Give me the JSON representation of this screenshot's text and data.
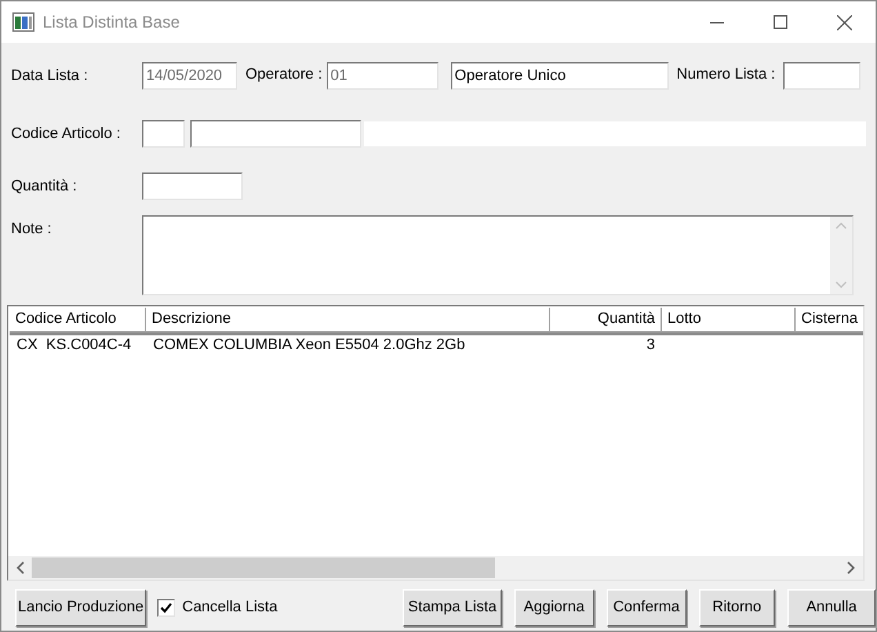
{
  "window": {
    "title": "Lista Distinta Base"
  },
  "form": {
    "data_lista": {
      "label": "Data Lista :",
      "value": "14/05/2020"
    },
    "operatore": {
      "label": "Operatore :",
      "code": "01",
      "name": "Operatore Unico"
    },
    "numero_lista": {
      "label": "Numero Lista :"
    },
    "codice_articolo": {
      "label": "Codice Articolo :"
    },
    "quantita": {
      "label": "Quantità :"
    },
    "note": {
      "label": "Note :"
    }
  },
  "table": {
    "columns": [
      {
        "label": "Codice Articolo",
        "numeric": false
      },
      {
        "label": "Descrizione",
        "numeric": false
      },
      {
        "label": "Quantità",
        "numeric": true
      },
      {
        "label": "Lotto",
        "numeric": false
      },
      {
        "label": "Cisterna",
        "numeric": false
      }
    ],
    "rows": [
      [
        "CX  KS.C004C-4",
        "COMEX COLUMBIA Xeon E5504 2.0Ghz 2Gb",
        "3",
        "",
        ""
      ]
    ]
  },
  "footer": {
    "buttons": [
      {
        "kind": "button",
        "label": "Lancio Produzione"
      },
      {
        "kind": "checkbox",
        "label": "Cancella Lista",
        "checked": true
      },
      {
        "kind": "button",
        "label": "Stampa Lista"
      },
      {
        "kind": "button",
        "label": "Aggiorna"
      },
      {
        "kind": "button",
        "label": "Conferma"
      },
      {
        "kind": "button",
        "label": "Ritorno"
      },
      {
        "kind": "button",
        "label": "Annulla"
      }
    ]
  }
}
